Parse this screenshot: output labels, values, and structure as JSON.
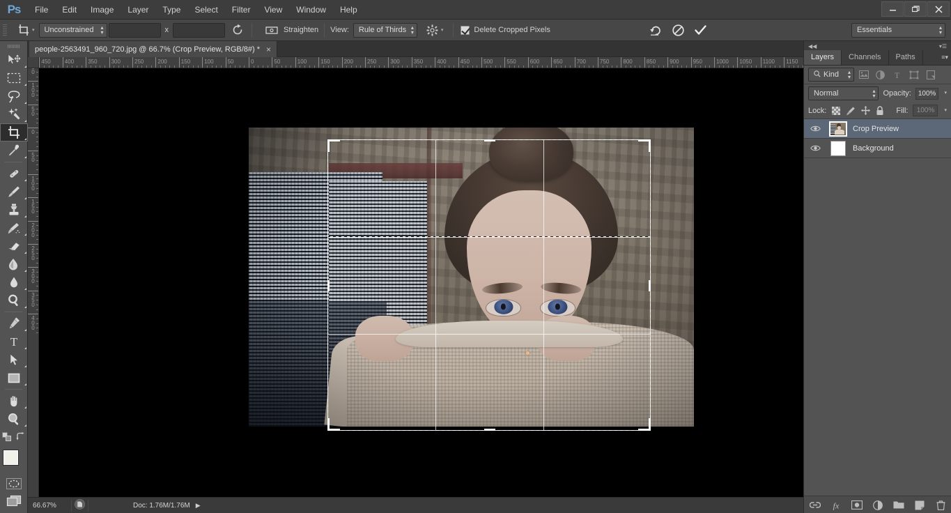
{
  "app": {
    "name": "Photoshop",
    "logo_text": "Ps"
  },
  "menubar": {
    "items": [
      "File",
      "Edit",
      "Image",
      "Layer",
      "Type",
      "Select",
      "Filter",
      "View",
      "Window",
      "Help"
    ],
    "window_controls": [
      "minimize",
      "restore",
      "close"
    ]
  },
  "options_bar": {
    "tool_icon": "crop-tool-icon",
    "ratio_select": "Unconstrained",
    "width_value": "",
    "height_value": "",
    "separator_x": "x",
    "swap_icon": "swap-dimensions-icon",
    "straighten_icon": "straighten-icon",
    "straighten_label": "Straighten",
    "view_label": "View:",
    "view_select": "Rule of Thirds",
    "gear_icon": "crop-options-gear-icon",
    "delete_cropped_label": "Delete Cropped Pixels",
    "delete_cropped_checked": true,
    "reset_icon": "reset-icon",
    "cancel_icon": "cancel-icon",
    "commit_icon": "commit-checkmark-icon",
    "workspace_select": "Essentials"
  },
  "document": {
    "tab_title": "people-2563491_960_720.jpg @ 66.7% (Crop Preview, RGB/8#) *",
    "close_glyph": "×"
  },
  "rulers": {
    "horizontal_labels": [
      "450",
      "400",
      "350",
      "300",
      "250",
      "200",
      "150",
      "100",
      "50",
      "0",
      "50",
      "100",
      "150",
      "200",
      "250",
      "300",
      "350",
      "400",
      "450",
      "500",
      "550",
      "600",
      "650",
      "700",
      "750",
      "800",
      "850",
      "900",
      "950",
      "1000",
      "1050",
      "1100",
      "1150"
    ],
    "vertical_labels": [
      "150",
      "100",
      "50",
      "0",
      "50",
      "100",
      "150",
      "200",
      "250",
      "300",
      "350",
      "400"
    ]
  },
  "toolbox": {
    "tools": [
      {
        "name": "move-tool",
        "active": false
      },
      {
        "name": "rectangular-marquee-tool",
        "active": false
      },
      {
        "name": "lasso-tool",
        "active": false
      },
      {
        "name": "quick-selection-tool",
        "active": false
      },
      {
        "name": "crop-tool",
        "active": true
      },
      {
        "name": "eyedropper-tool",
        "active": false
      },
      {
        "name": "spot-healing-brush-tool",
        "active": false
      },
      {
        "name": "brush-tool",
        "active": false
      },
      {
        "name": "clone-stamp-tool",
        "active": false
      },
      {
        "name": "history-brush-tool",
        "active": false
      },
      {
        "name": "eraser-tool",
        "active": false
      },
      {
        "name": "gradient-tool",
        "active": false
      },
      {
        "name": "blur-tool",
        "active": false
      },
      {
        "name": "dodge-tool",
        "active": false
      },
      {
        "name": "pen-tool",
        "active": false
      },
      {
        "name": "type-tool",
        "active": false
      },
      {
        "name": "path-selection-tool",
        "active": false
      },
      {
        "name": "rectangle-tool",
        "active": false
      },
      {
        "name": "hand-tool",
        "active": false
      },
      {
        "name": "zoom-tool",
        "active": false
      }
    ],
    "foreground_color": "#f2f0eb",
    "background_color": "#ffffff",
    "quick_mask_icon": "quick-mask-icon",
    "screen-mode_icon": "screen-mode-icon"
  },
  "canvas": {
    "background_color": "#000000",
    "crop_overlay": {
      "guide_type": "Rule of Thirds",
      "center_marker": "crop-center-target-icon"
    },
    "image_description": "woman pulling cream knit sweater over face, hair in a bun"
  },
  "statusbar": {
    "zoom_level": "66.67%",
    "doc_info": "Doc: 1.76M/1.76M",
    "expand_glyph": "▶",
    "thumb_icon": "document-status-icon"
  },
  "panels": {
    "collapse_icon": "collapse-panels-icon",
    "menu_icon": "panel-menu-icon",
    "tabs": [
      {
        "label": "Layers",
        "active": true
      },
      {
        "label": "Channels",
        "active": false
      },
      {
        "label": "Paths",
        "active": false
      }
    ],
    "filter": {
      "search_icon": "search-icon",
      "kind_select": "Kind",
      "icons": [
        "filter-pixel-icon",
        "filter-adjustment-icon",
        "filter-type-icon",
        "filter-shape-icon",
        "filter-smart-object-icon"
      ]
    },
    "blend": {
      "mode_select": "Normal",
      "opacity_label": "Opacity:",
      "opacity_value": "100%"
    },
    "lock": {
      "label": "Lock:",
      "icons": [
        "lock-transparent-pixels-icon",
        "lock-image-pixels-icon",
        "lock-position-icon",
        "lock-all-icon"
      ],
      "fill_label": "Fill:",
      "fill_value": "100%"
    },
    "layers": [
      {
        "name": "Crop Preview",
        "visible": true,
        "selected": true,
        "thumb": "photo"
      },
      {
        "name": "Background",
        "visible": true,
        "selected": false,
        "thumb": "white"
      }
    ],
    "footer_icons": [
      "link-layers-icon",
      "layer-styles-fx-icon",
      "add-layer-mask-icon",
      "new-adjustment-layer-icon",
      "new-group-icon",
      "new-layer-icon",
      "delete-layer-icon"
    ]
  },
  "colors": {
    "menu_bg": "#3d3d3d",
    "options_bg": "#474747",
    "panel_bg": "#535353",
    "canvas_bg": "#000000",
    "selection_blue": "#5c6877",
    "logo_blue": "#6ea8d8"
  }
}
